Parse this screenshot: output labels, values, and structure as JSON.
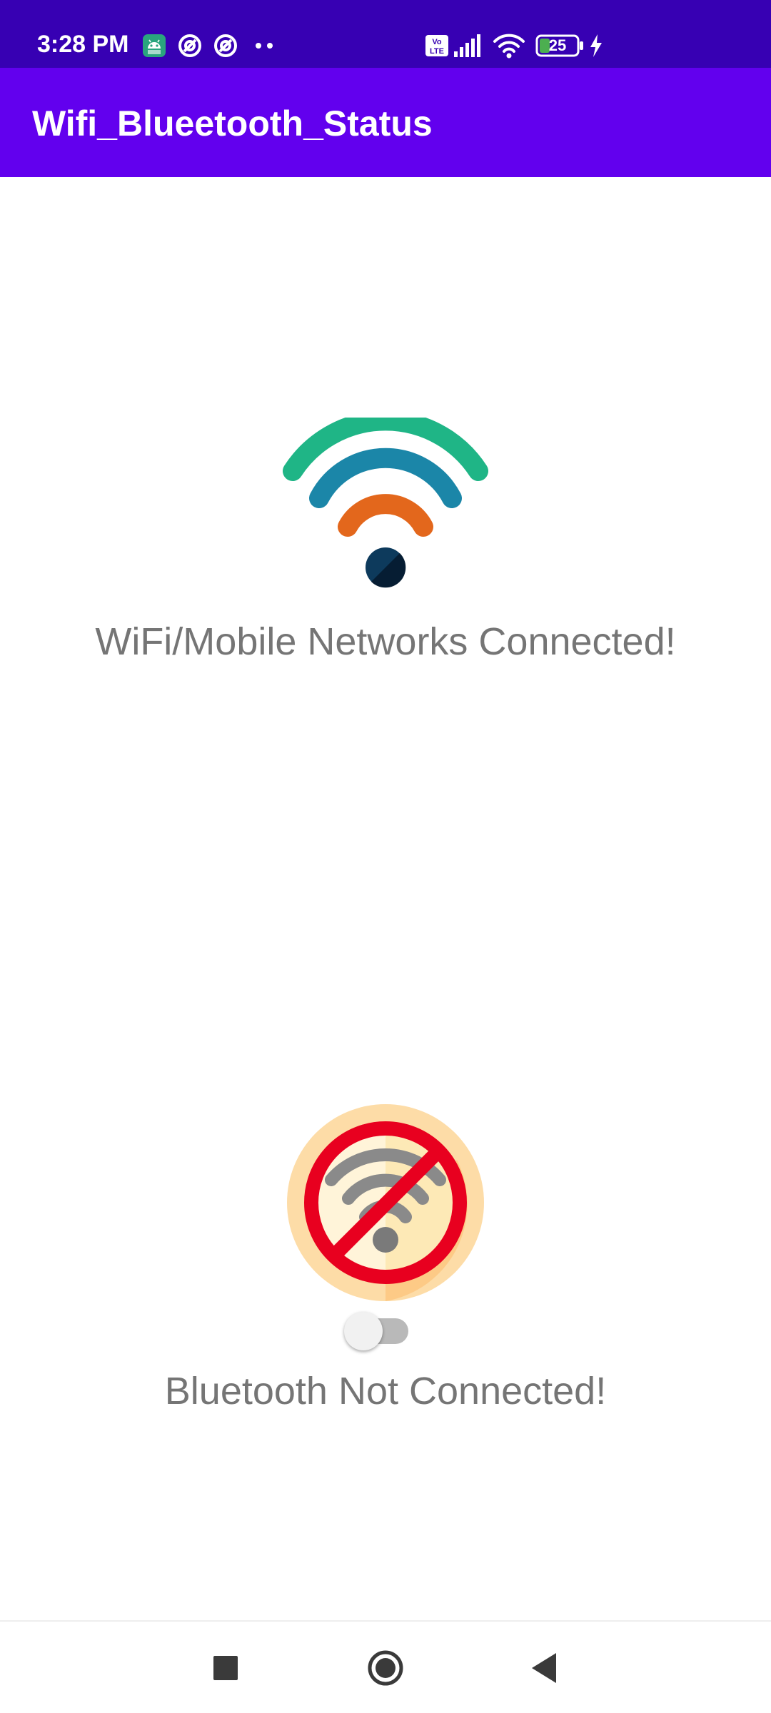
{
  "status_bar": {
    "time": "3:28 PM",
    "battery_level": "25",
    "icons": [
      "android-app-icon",
      "at-sign-icon",
      "at-sign-icon",
      "more-notifications-icon",
      "volte-icon",
      "cell-signal-icon",
      "wifi-signal-icon",
      "battery-icon",
      "charging-icon"
    ]
  },
  "app_bar": {
    "title": "Wifi_Blueetooth_Status"
  },
  "wifi_section": {
    "icon": "wifi-connected-icon",
    "status_text": "WiFi/Mobile Networks Connected!"
  },
  "bluetooth_section": {
    "icon": "no-connection-icon",
    "switch_on": false,
    "status_text": "Bluetooth Not Connected!"
  },
  "nav_bar": {
    "buttons": [
      "recents-button",
      "home-button",
      "back-button"
    ]
  },
  "colors": {
    "status_bar": "#3700b3",
    "app_bar": "#6200ee",
    "status_text": "#757575"
  }
}
